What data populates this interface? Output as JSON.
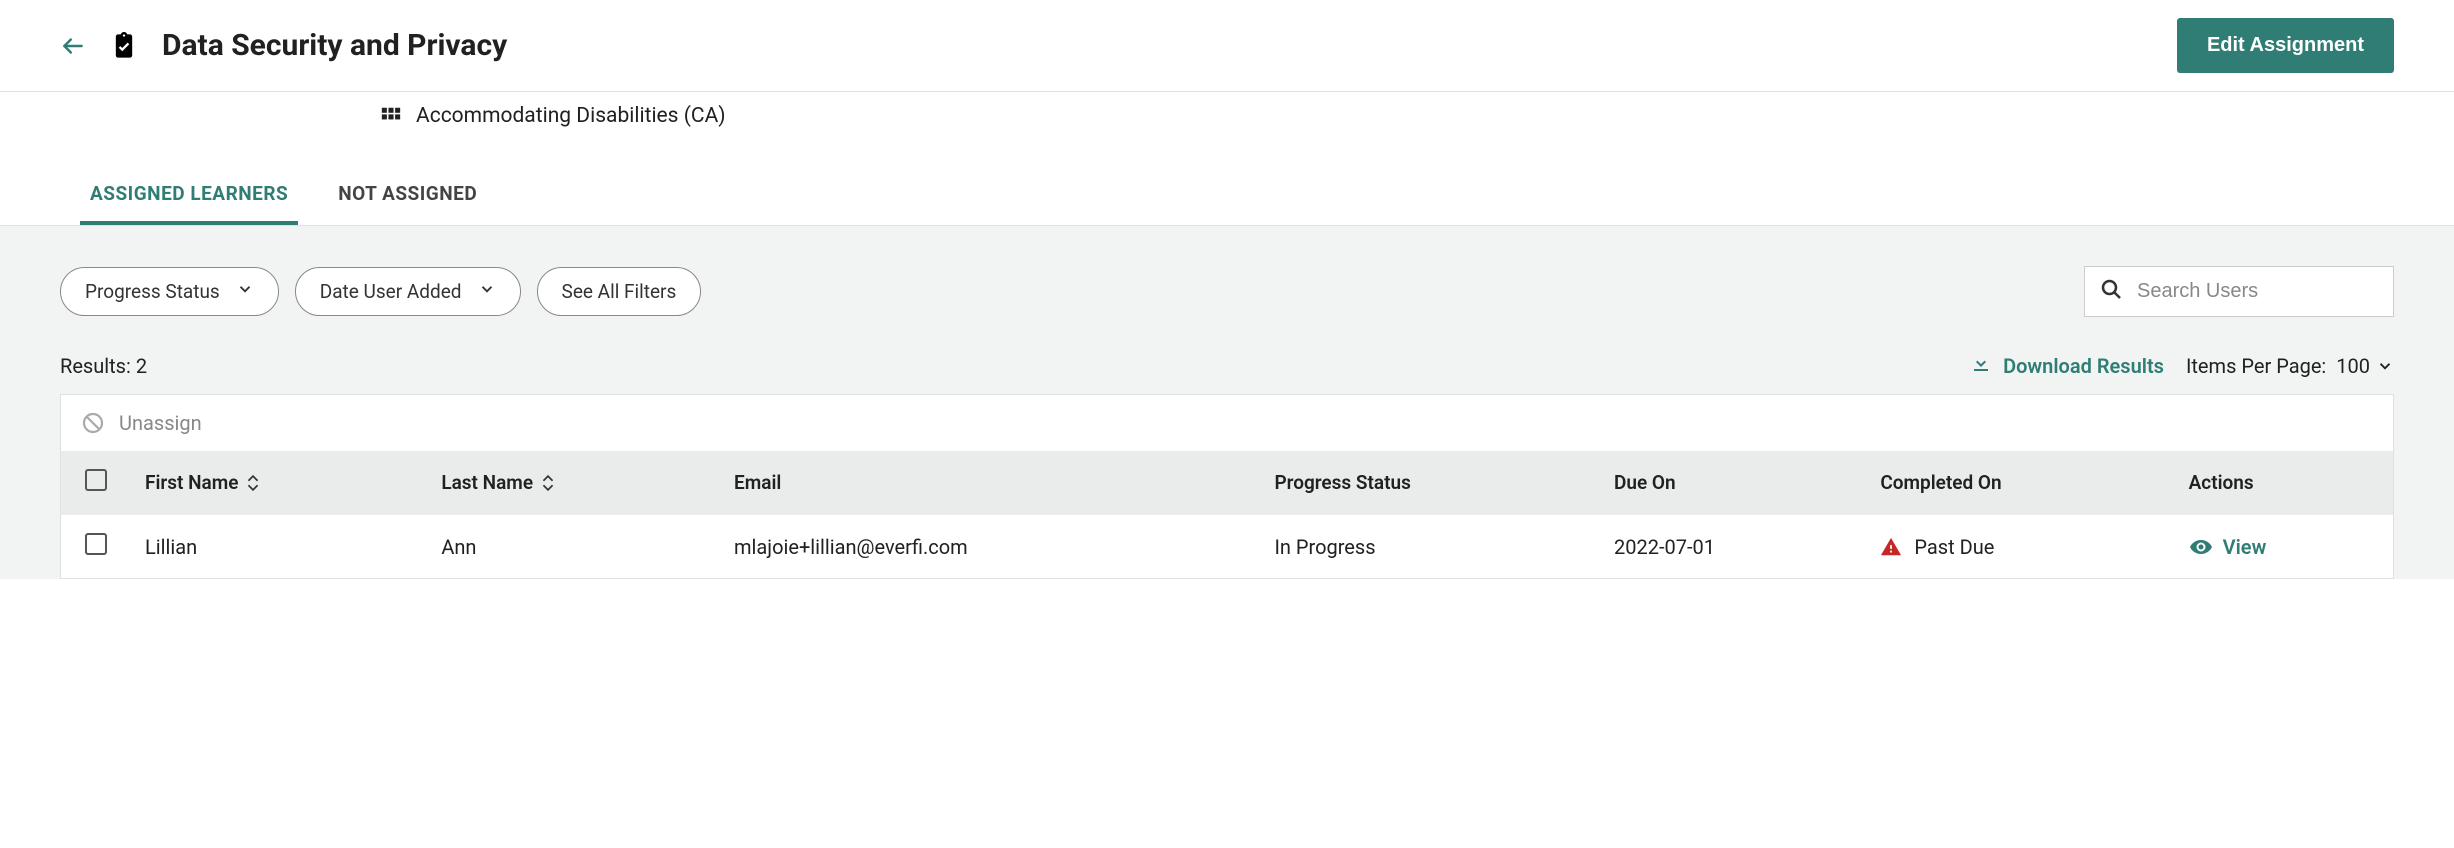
{
  "header": {
    "title": "Data Security and Privacy",
    "edit_button": "Edit Assignment"
  },
  "course": {
    "name": "Accommodating Disabilities (CA)"
  },
  "tabs": {
    "assigned": "ASSIGNED LEARNERS",
    "not_assigned": "NOT ASSIGNED"
  },
  "filters": {
    "progress_status": "Progress Status",
    "date_added": "Date User Added",
    "see_all": "See All Filters"
  },
  "search": {
    "placeholder": "Search Users"
  },
  "results": {
    "label": "Results:",
    "count": "2",
    "download": "Download Results",
    "ipp_label": "Items Per Page:",
    "ipp_value": "100"
  },
  "table": {
    "unassign": "Unassign",
    "cols": {
      "first_name": "First Name",
      "last_name": "Last Name",
      "email": "Email",
      "progress_status": "Progress Status",
      "due_on": "Due On",
      "completed_on": "Completed On",
      "actions": "Actions"
    },
    "rows": [
      {
        "first_name": "Lillian",
        "last_name": "Ann",
        "email": "mlajoie+lillian@everfi.com",
        "progress_status": "In Progress",
        "due_on": "2022-07-01",
        "completed_on": "Past Due",
        "action": "View"
      }
    ]
  }
}
